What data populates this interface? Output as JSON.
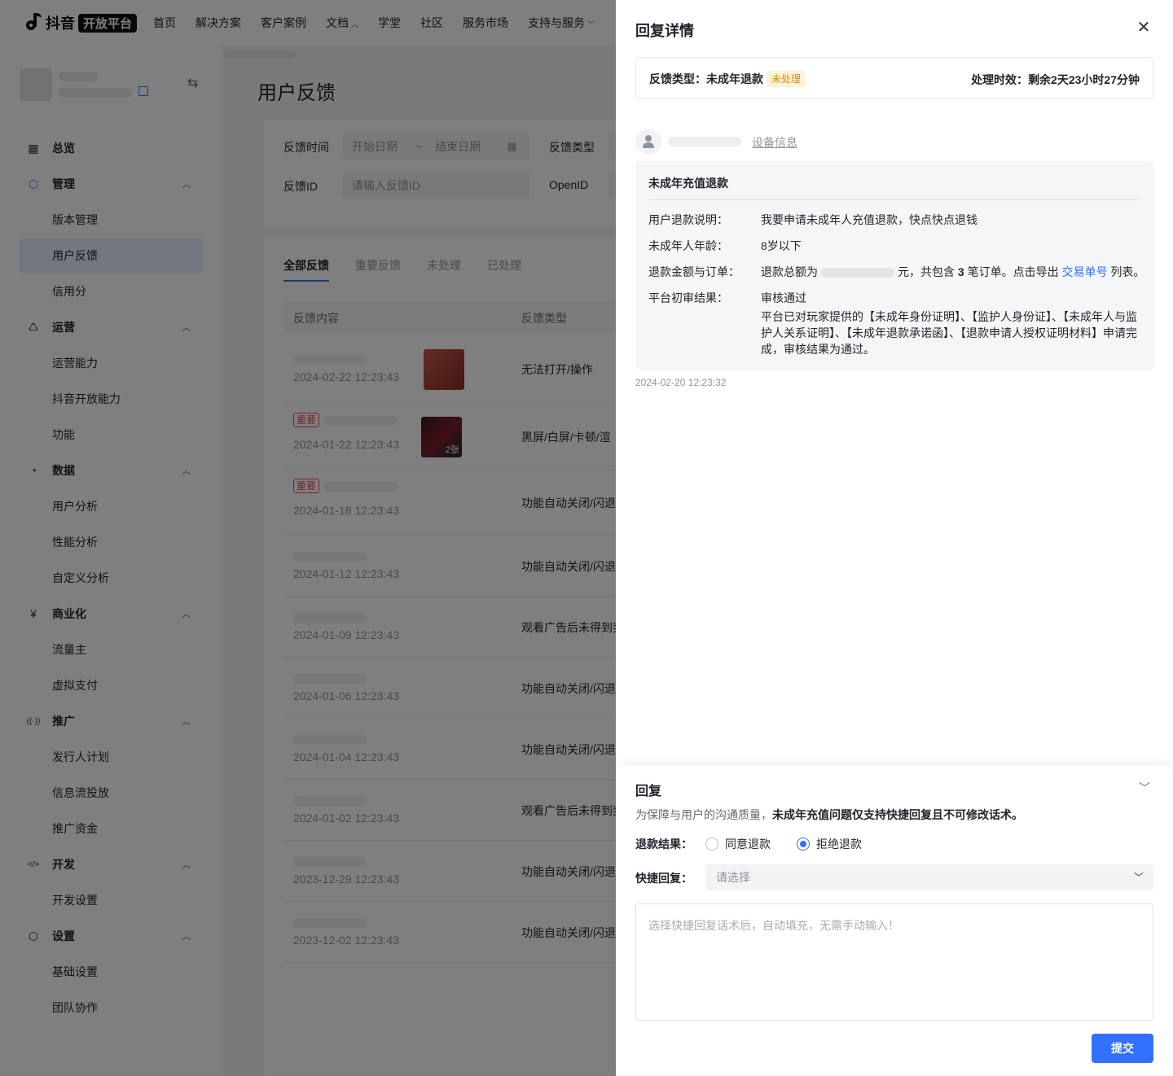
{
  "topnav": {
    "logo_text": "抖音",
    "logo_pill": "开放平台",
    "items": [
      {
        "label": "首页",
        "has_dropdown": false
      },
      {
        "label": "解决方案",
        "has_dropdown": false
      },
      {
        "label": "客户案例",
        "has_dropdown": false
      },
      {
        "label": "文档",
        "has_dropdown": true
      },
      {
        "label": "学堂",
        "has_dropdown": false
      },
      {
        "label": "社区",
        "has_dropdown": false
      },
      {
        "label": "服务市场",
        "has_dropdown": false
      },
      {
        "label": "支持与服务",
        "has_dropdown": true
      }
    ]
  },
  "sidebar": {
    "groups": [
      {
        "label": "总览",
        "icon": "dashboard-icon",
        "items": []
      },
      {
        "label": "管理",
        "icon": "cube-icon",
        "items": [
          "版本管理",
          "用户反馈",
          "信用分"
        ]
      },
      {
        "label": "运营",
        "icon": "bell-icon",
        "items": [
          "运营能力",
          "抖音开放能力",
          "功能"
        ]
      },
      {
        "label": "数据",
        "icon": "pie-chart-icon",
        "items": [
          "用户分析",
          "性能分析",
          "自定义分析"
        ]
      },
      {
        "label": "商业化",
        "icon": "yuan-icon",
        "items": [
          "流量主",
          "虚拟支付"
        ]
      },
      {
        "label": "推广",
        "icon": "broadcast-icon",
        "items": [
          "发行人计划",
          "信息流投放",
          "推广资金"
        ]
      },
      {
        "label": "开发",
        "icon": "code-icon",
        "items": [
          "开发设置"
        ]
      },
      {
        "label": "设置",
        "icon": "settings-icon",
        "items": [
          "基础设置",
          "团队协作"
        ]
      }
    ],
    "active_item": "用户反馈"
  },
  "main": {
    "title": "用户反馈",
    "filters": {
      "time_label": "反馈时间",
      "start_placeholder": "开始日期",
      "range_sep": "~",
      "end_placeholder": "结束日期",
      "type_label": "反馈类型",
      "id_label": "反馈ID",
      "id_placeholder": "请输入反馈ID",
      "openid_label": "OpenID"
    },
    "tabs": [
      "全部反馈",
      "重要反馈",
      "未处理",
      "已处理"
    ],
    "table_headers": [
      "反馈内容",
      "反馈类型"
    ],
    "rows": [
      {
        "date": "2024-02-22 12:23:43",
        "type": "无法打开/操作",
        "important": false
      },
      {
        "date": "2024-01-22 12:23:43",
        "type": "黑屏/白屏/卡顿/渲",
        "important": true
      },
      {
        "date": "2024-01-18 12:23:43",
        "type": "功能自动关闭/闪退",
        "important": true
      },
      {
        "date": "2024-01-12 12:23:43",
        "type": "功能自动关闭/闪退",
        "important": false
      },
      {
        "date": "2024-01-09 12:23:43",
        "type": "观看广告后未得到奖",
        "important": false
      },
      {
        "date": "2024-01-06 12:23:43",
        "type": "功能自动关闭/闪退",
        "important": false
      },
      {
        "date": "2024-01-04 12:23:43",
        "type": "功能自动关闭/闪退",
        "important": false
      },
      {
        "date": "2024-01-02 12:23:43",
        "type": "观看广告后未得到奖",
        "important": false
      },
      {
        "date": "2023-12-29 12:23:43",
        "type": "功能自动关闭/闪退",
        "important": false
      },
      {
        "date": "2023-12-02 12:23:43",
        "type": "功能自动关闭/闪退",
        "important": false
      }
    ],
    "important_tag": "重要",
    "thumb_count_label": "2张"
  },
  "drawer": {
    "title": "回复详情",
    "summary": {
      "type_label": "反馈类型：",
      "type_value": "未成年退款",
      "status": "未处理",
      "deadline_label": "处理时效：",
      "deadline_value": "剩余2天23小时27分钟"
    },
    "device_link": "设备信息",
    "detail": {
      "title": "未成年充值退款",
      "reason_label": "用户退款说明：",
      "reason_value": "我要申请未成年人充值退款，快点快点退钱",
      "age_label": "未成年人年龄：",
      "age_value": "8岁以下",
      "amount_label": "退款金额与订单：",
      "amount_prefix": "退款总额为",
      "amount_mid": "元，共包含",
      "order_count": "3",
      "amount_suffix": "笔订单。点击导出",
      "orders_link": "交易单号",
      "amount_tail": "列表。",
      "result_label": "平台初审结果：",
      "result_value": "审核通过",
      "result_desc": "平台已对玩家提供的【未成年身份证明】、【监护人身份证】、【未成年人与监护人关系证明】、【未成年退款承诺函】、【退款申请人授权证明材料】申请完成，审核结果为通过。"
    },
    "timestamp": "2024-02-20 12:23:32",
    "reply": {
      "title": "回复",
      "hint_prefix": "为保障与用户的沟通质量，",
      "hint_bold": "未成年充值问题仅支持快捷回复且不可修改话术。",
      "result_label": "退款结果：",
      "option_agree": "同意退款",
      "option_reject": "拒绝退款",
      "selected": "拒绝退款",
      "quick_label": "快捷回复：",
      "quick_placeholder": "请选择",
      "textarea_placeholder": "选择快捷回复话术后，自动填充，无需手动输入！",
      "submit_label": "提交"
    }
  },
  "colors": {
    "primary": "#3370ff",
    "warning_bg": "#fff3d6",
    "warning_text": "#d98b0a",
    "danger": "#e34d59",
    "mask": "rgba(0,0,0,0.5)"
  }
}
